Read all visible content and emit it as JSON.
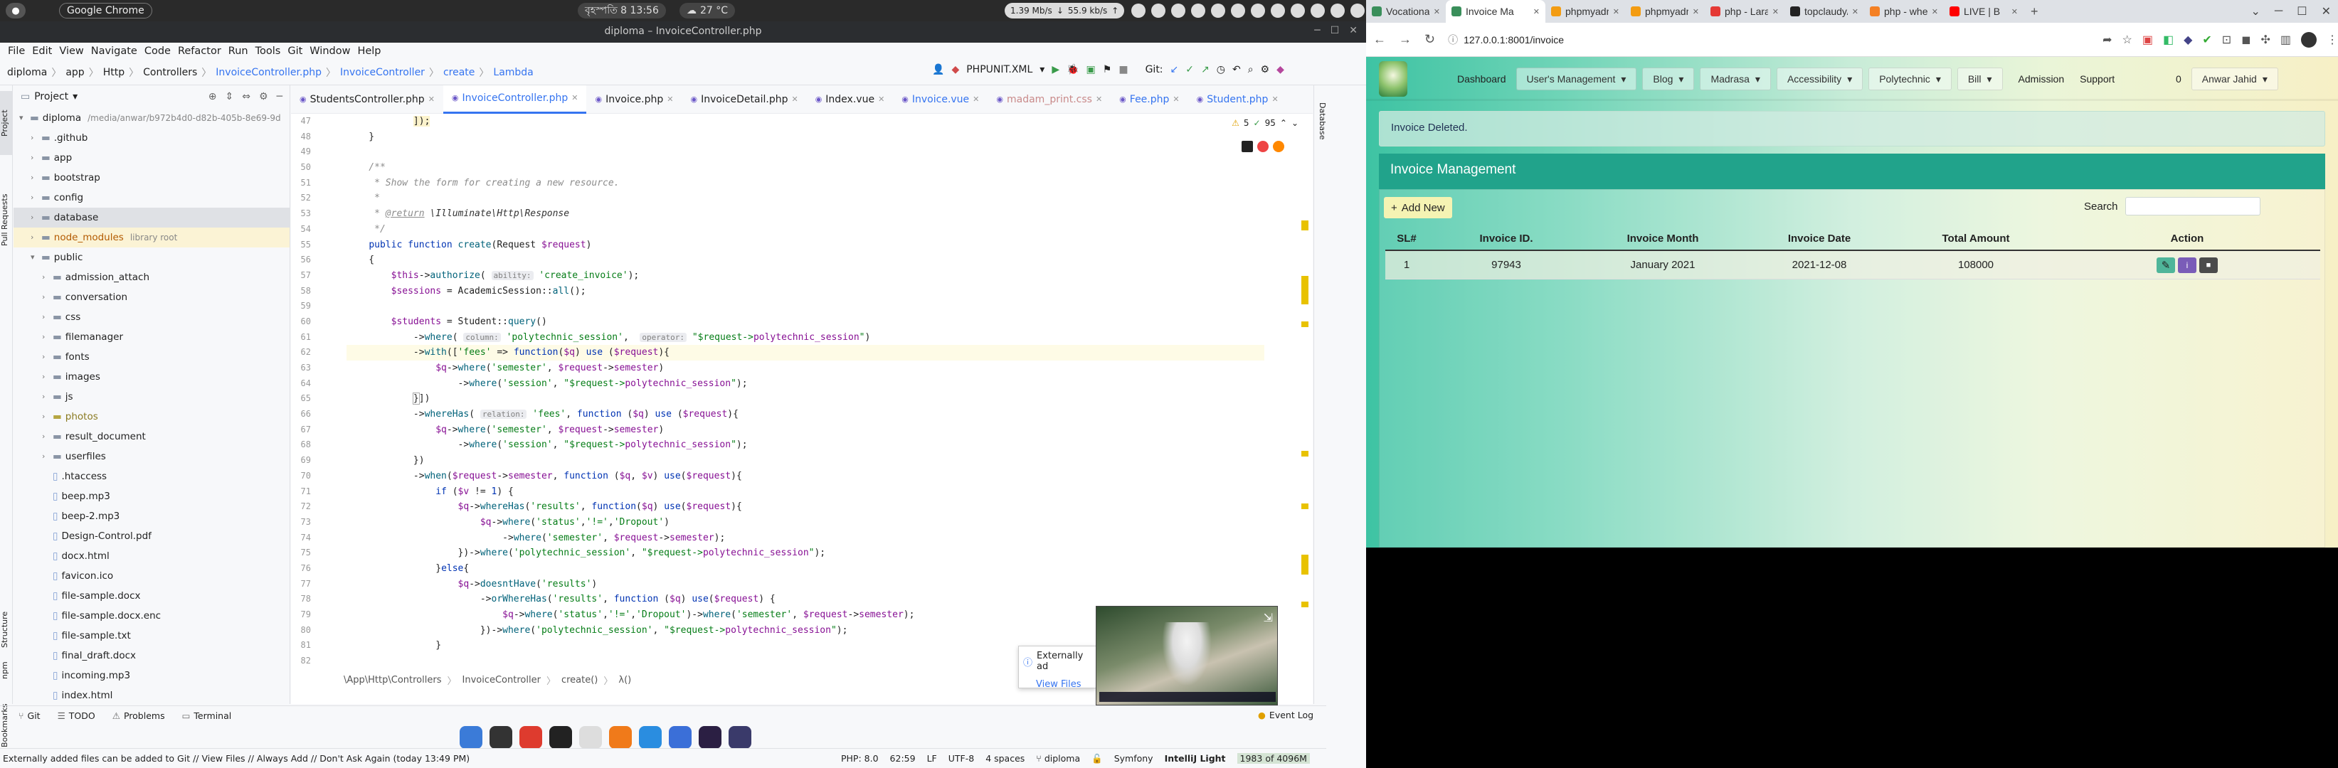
{
  "system_bar": {
    "activities_label": "Google Chrome",
    "datetime": "বৃহস্পতি 8 13:56",
    "weather": "27 °C",
    "net_down": "1.39 Mb/s",
    "net_up": "55.9 kb/s"
  },
  "ide": {
    "window_title": "diploma – InvoiceController.php",
    "menu": [
      "File",
      "Edit",
      "View",
      "Navigate",
      "Code",
      "Refactor",
      "Run",
      "Tools",
      "Git",
      "Window",
      "Help"
    ],
    "breadcrumbs": [
      "diploma",
      "app",
      "Http",
      "Controllers",
      "InvoiceController.php",
      "InvoiceController",
      "create",
      "Lambda"
    ],
    "run_config": "PHPUNIT.XML",
    "git_label": "Git:",
    "project_label": "Project",
    "left_strip": [
      "Project",
      "Pull Requests",
      "Structure",
      "npm",
      "Bookmarks"
    ],
    "right_strip": [
      "Database"
    ],
    "tree": [
      {
        "label": "diploma",
        "extra": "/media/anwar/b972b4d0-d82b-405b-8e69-9d",
        "level": 0,
        "type": "folder",
        "open": true
      },
      {
        "label": ".github",
        "level": 1,
        "type": "folder"
      },
      {
        "label": "app",
        "level": 1,
        "type": "folder"
      },
      {
        "label": "bootstrap",
        "level": 1,
        "type": "folder"
      },
      {
        "label": "config",
        "level": 1,
        "type": "folder"
      },
      {
        "label": "database",
        "level": 1,
        "type": "folder",
        "selected": true
      },
      {
        "label": "node_modules",
        "extra": "library root",
        "level": 1,
        "type": "folder",
        "highlight": true
      },
      {
        "label": "public",
        "level": 1,
        "type": "folder",
        "open": true
      },
      {
        "label": "admission_attach",
        "level": 2,
        "type": "folder"
      },
      {
        "label": "conversation",
        "level": 2,
        "type": "folder"
      },
      {
        "label": "css",
        "level": 2,
        "type": "folder"
      },
      {
        "label": "filemanager",
        "level": 2,
        "type": "folder"
      },
      {
        "label": "fonts",
        "level": 2,
        "type": "folder"
      },
      {
        "label": "images",
        "level": 2,
        "type": "folder"
      },
      {
        "label": "js",
        "level": 2,
        "type": "folder"
      },
      {
        "label": "photos",
        "level": 2,
        "type": "folder",
        "olive": true
      },
      {
        "label": "result_document",
        "level": 2,
        "type": "folder"
      },
      {
        "label": "userfiles",
        "level": 2,
        "type": "folder"
      },
      {
        "label": ".htaccess",
        "level": 2,
        "type": "file"
      },
      {
        "label": "beep.mp3",
        "level": 2,
        "type": "file"
      },
      {
        "label": "beep-2.mp3",
        "level": 2,
        "type": "file"
      },
      {
        "label": "Design-Control.pdf",
        "level": 2,
        "type": "file"
      },
      {
        "label": "docx.html",
        "level": 2,
        "type": "file"
      },
      {
        "label": "favicon.ico",
        "level": 2,
        "type": "file"
      },
      {
        "label": "file-sample.docx",
        "level": 2,
        "type": "file"
      },
      {
        "label": "file-sample.docx.enc",
        "level": 2,
        "type": "file"
      },
      {
        "label": "file-sample.txt",
        "level": 2,
        "type": "file"
      },
      {
        "label": "final_draft.docx",
        "level": 2,
        "type": "file"
      },
      {
        "label": "incoming.mp3",
        "level": 2,
        "type": "file"
      },
      {
        "label": "index.html",
        "level": 2,
        "type": "file"
      }
    ],
    "tabs": [
      {
        "label": "StudentsController.php",
        "color": "#222",
        "active": false
      },
      {
        "label": "InvoiceController.php",
        "color": "#3574f0",
        "active": true
      },
      {
        "label": "Invoice.php",
        "color": "#222",
        "active": false
      },
      {
        "label": "InvoiceDetail.php",
        "color": "#222",
        "active": false
      },
      {
        "label": "Index.vue",
        "color": "#222",
        "active": false
      },
      {
        "label": "Invoice.vue",
        "color": "#3574f0",
        "active": false
      },
      {
        "label": "madam_print.css",
        "color": "#c98a8a",
        "active": false
      },
      {
        "label": "Fee.php",
        "color": "#3574f0",
        "active": false
      },
      {
        "label": "Student.php",
        "color": "#3574f0",
        "active": false
      }
    ],
    "inspection": {
      "warnings": "5",
      "typos": "95"
    },
    "line_numbers": [
      "47",
      "48",
      "49",
      "50",
      "51",
      "52",
      "53",
      "54",
      "55",
      "56",
      "57",
      "58",
      "59",
      "60",
      "61",
      "62",
      "63",
      "64",
      "65",
      "66",
      "67",
      "68",
      "69",
      "70",
      "71",
      "72",
      "73",
      "74",
      "75",
      "76",
      "77",
      "78",
      "79",
      "80",
      "81",
      "82"
    ],
    "code_breadcrumb": [
      "\\App\\Http\\Controllers",
      "InvoiceController",
      "create()",
      "λ()"
    ],
    "bottom_tabs": [
      "Git",
      "TODO",
      "Problems",
      "Terminal"
    ],
    "event_log": "Event Log",
    "notification": {
      "title": "Externally ad",
      "link": "View Files"
    },
    "status_message": "Externally added files can be added to Git // View Files // Always Add // Don't Ask Again (today 13:49 PM)",
    "status_right": {
      "php": "PHP: 8.0",
      "position": "62:59",
      "line_sep": "LF",
      "encoding": "UTF-8",
      "indent": "4 spaces",
      "branch": "diploma",
      "framework": "Symfony",
      "theme": "IntelliJ Light",
      "memory": "1983 of 4096M"
    }
  },
  "taskbar": [
    "thunderbird-icon",
    "rhythmbox-icon",
    "chrome-icon",
    "video-icon",
    "text-editor-icon",
    "firefox-icon",
    "screenshot-icon",
    "files-icon",
    "phpstorm-icon",
    "software-icon"
  ],
  "browser": {
    "tabs": [
      {
        "label": "Vocational |",
        "active": false
      },
      {
        "label": "Invoice Ma",
        "active": true
      },
      {
        "label": "phpmyadmi",
        "active": false
      },
      {
        "label": "phpmyadmi",
        "active": false
      },
      {
        "label": "php - Larav",
        "active": false
      },
      {
        "label": "topclaudy/c",
        "active": false
      },
      {
        "label": "php - when",
        "active": false
      },
      {
        "label": "LIVE | B",
        "active": false
      }
    ],
    "url": "127.0.0.1:8001/invoice",
    "nav": {
      "dashboard": "Dashboard",
      "dropdowns": [
        "User's Management",
        "Blog",
        "Madrasa",
        "Accessibility",
        "Polytechnic",
        "Bill"
      ],
      "admission": "Admission",
      "support": "Support",
      "notif_count": "0",
      "user": "Anwar Jahid"
    },
    "alert": "Invoice Deleted.",
    "page_title": "Invoice Management",
    "add_new": "Add New",
    "search_label": "Search",
    "search_value": "",
    "table": {
      "headers": [
        "SL#",
        "Invoice ID.",
        "Invoice Month",
        "Invoice Date",
        "Total Amount",
        "Action"
      ],
      "rows": [
        {
          "sl": "1",
          "id": "97943",
          "month": "January 2021",
          "date": "2021-12-08",
          "amount": "108000"
        }
      ]
    },
    "colors": {
      "teal": "#29b89f",
      "green": "#1f9d5a",
      "edit": "#4fb59a",
      "info": "#7a5cb8",
      "delete": "#4b4b4b"
    }
  }
}
